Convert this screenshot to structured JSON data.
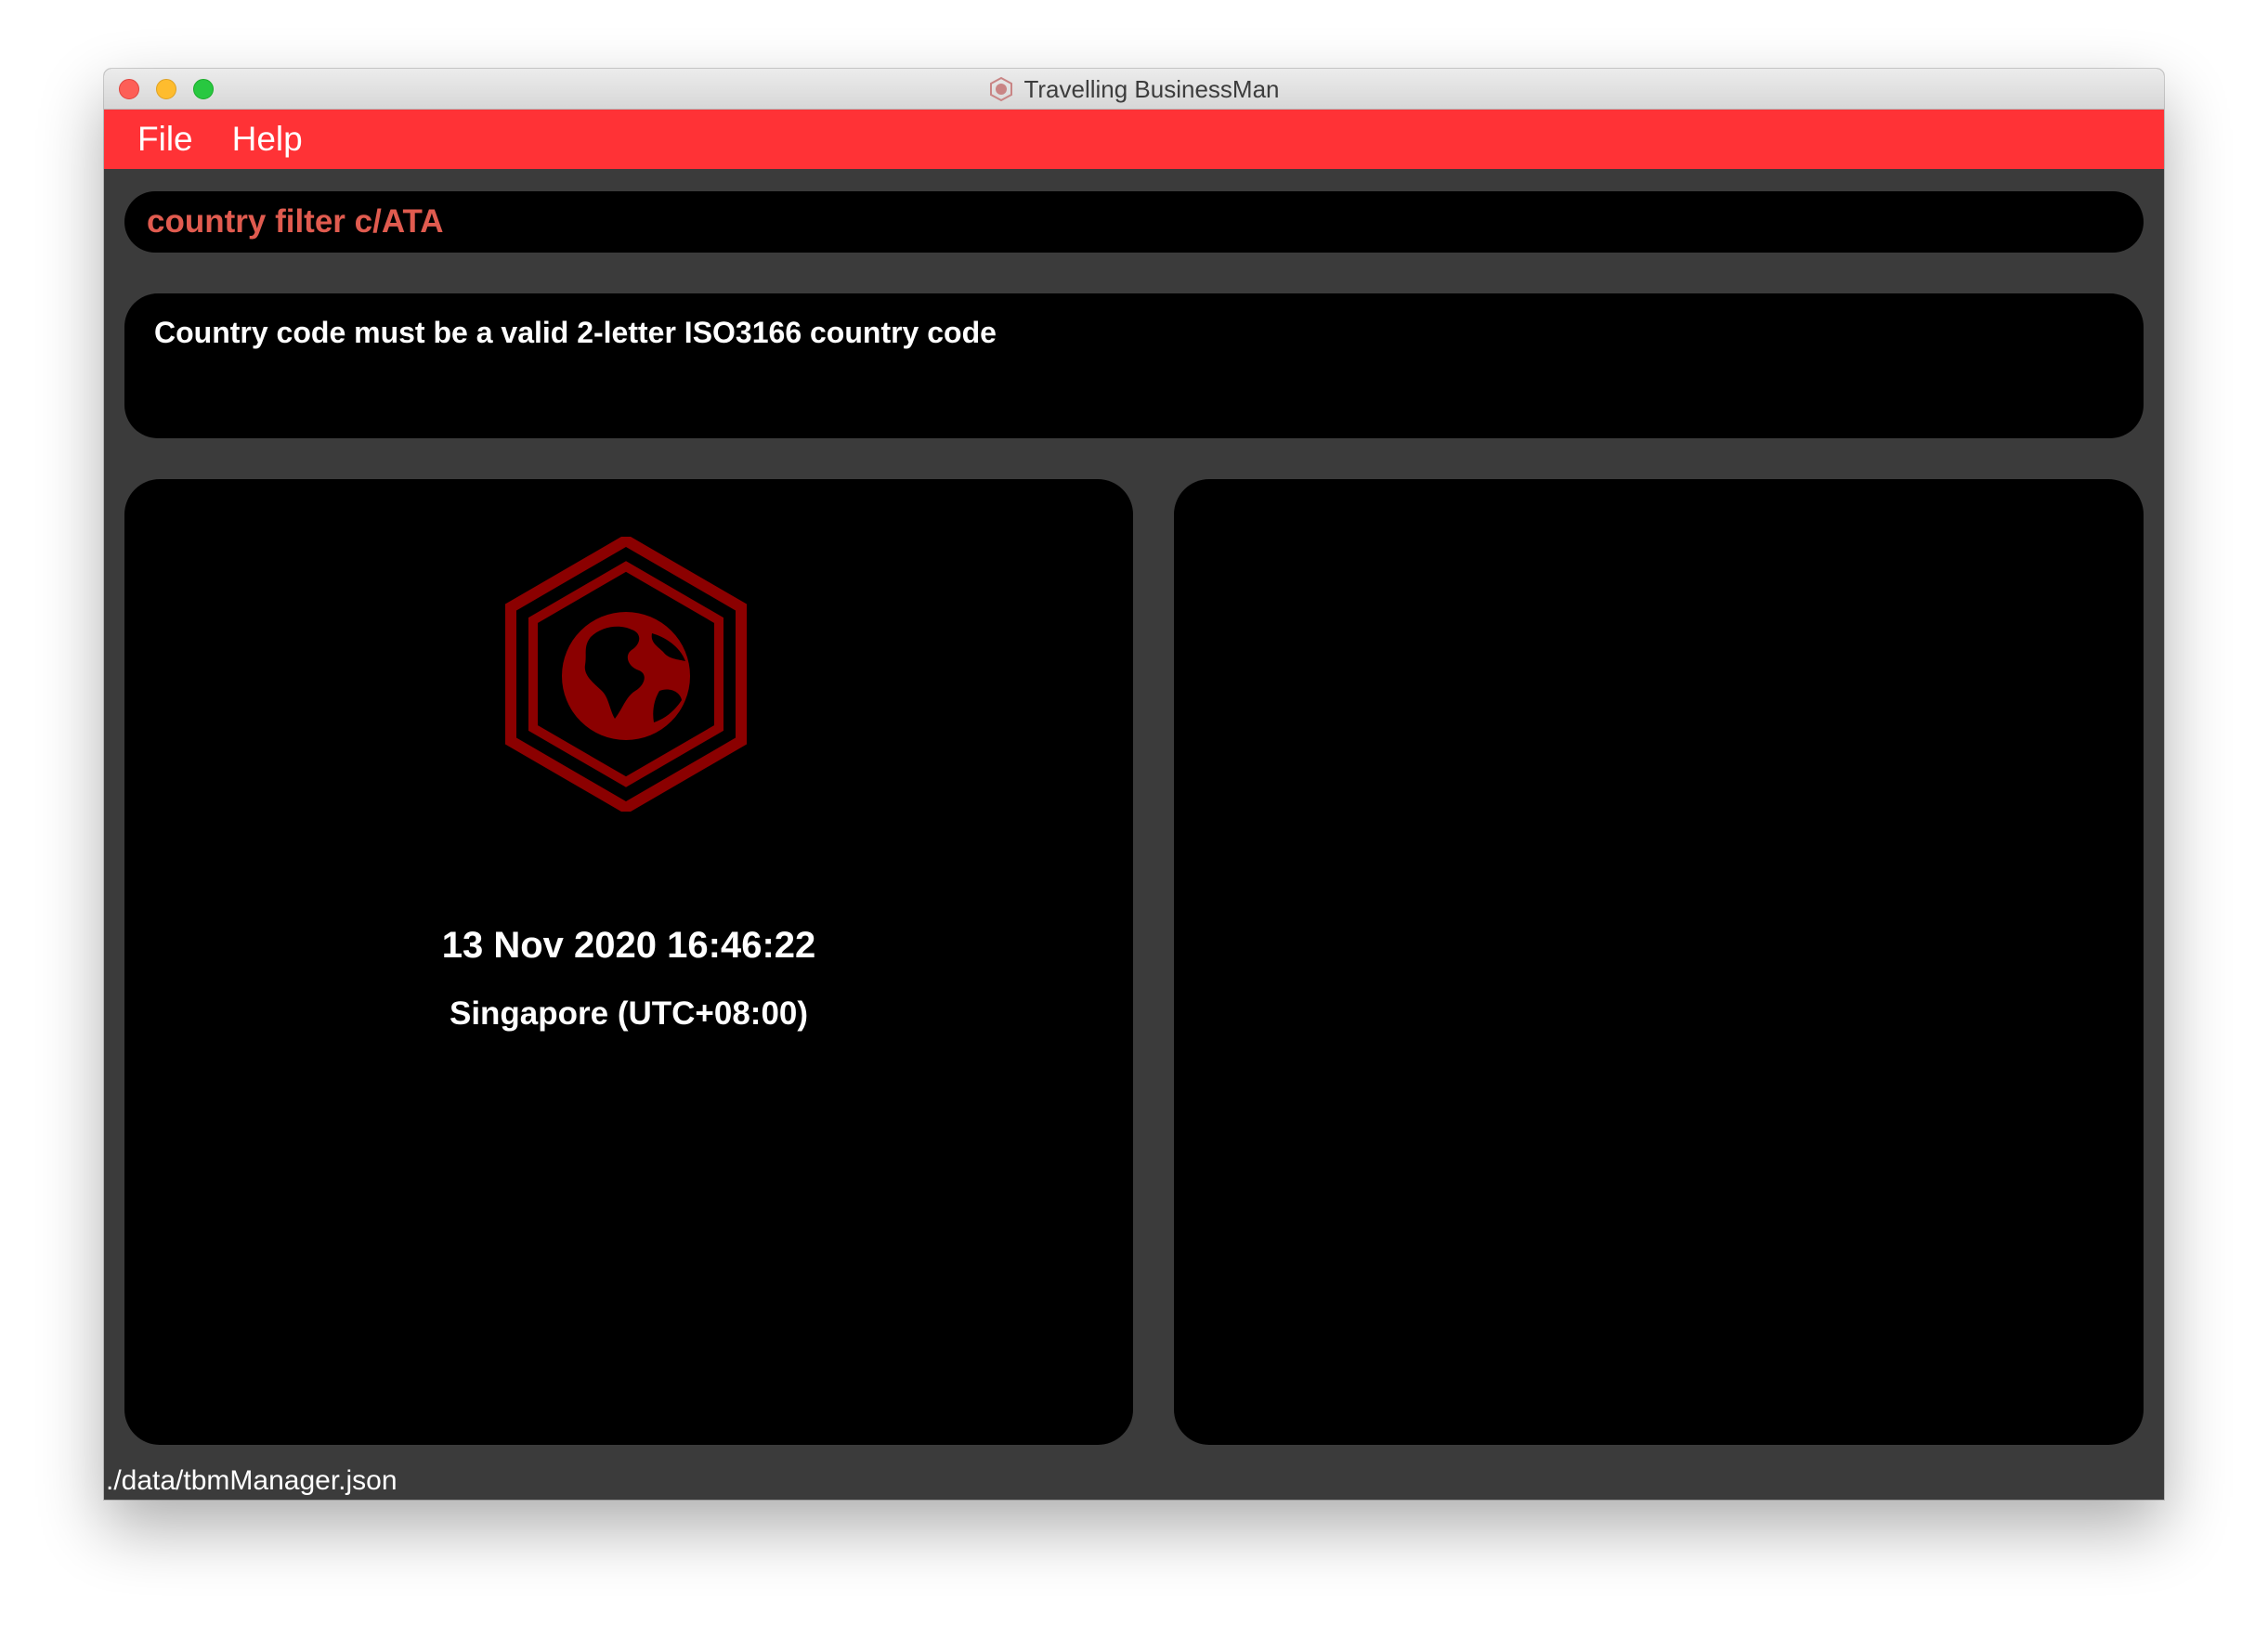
{
  "window": {
    "title": "Travelling BusinessMan"
  },
  "menu": {
    "items": [
      {
        "label": "File"
      },
      {
        "label": "Help"
      }
    ]
  },
  "command": {
    "value": "country filter c/ATA"
  },
  "result": {
    "message": "Country code must be a valid 2-letter ISO3166 country code"
  },
  "clock": {
    "datetime": "13 Nov 2020 16:46:22",
    "timezone": "Singapore (UTC+08:00)",
    "logo_icon": "hexagon-globe-icon"
  },
  "status": {
    "file_path": "./data/tbmManager.json"
  },
  "colors": {
    "menu_bar": "#ff3236",
    "command_text": "#e05b4f",
    "logo": "#8b0000",
    "panel_background": "#000000",
    "window_background": "#3b3b3b"
  }
}
